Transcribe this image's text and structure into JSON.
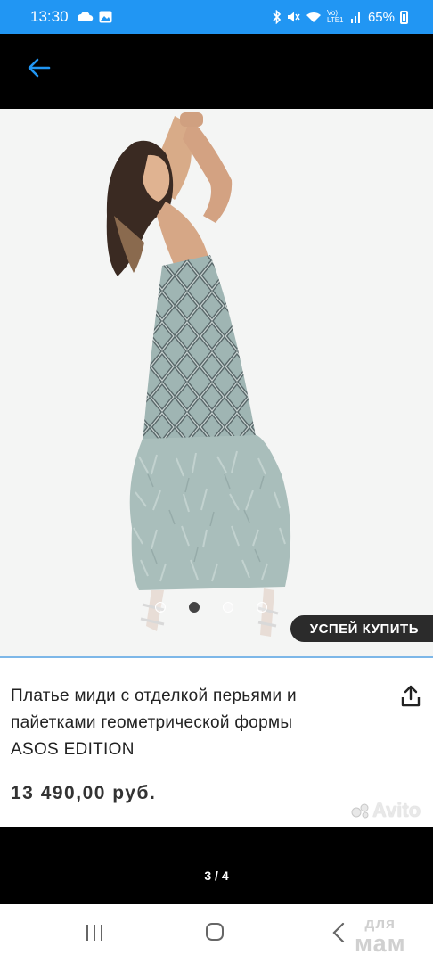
{
  "status_bar": {
    "time": "13:30",
    "battery": "65%",
    "network_label": "Vo) LTE1",
    "icons": [
      "cloud-sync-icon",
      "gallery-icon",
      "bluetooth-icon",
      "mute-icon",
      "wifi-icon",
      "signal-icon",
      "battery-icon"
    ]
  },
  "header": {
    "back_icon": "arrow-left-icon"
  },
  "photo": {
    "slides_total": 4,
    "active_dot": 2,
    "badge": "УСПЕЙ КУПИТЬ"
  },
  "product": {
    "title_line1": "Платье миди с отделкой перьями и",
    "title_line2": "пайетками геометрической формы",
    "title_line3": "ASOS EDITION",
    "price": "13 490,00 руб.",
    "share_icon": "share-icon"
  },
  "watermark": "Avito",
  "page_counter": "3 / 4",
  "site_logo": {
    "line1": "для",
    "line2": "мам"
  },
  "colors": {
    "status_bar": "#2196f3",
    "accent": "#2196f3",
    "badge": "#2b2b2b"
  }
}
